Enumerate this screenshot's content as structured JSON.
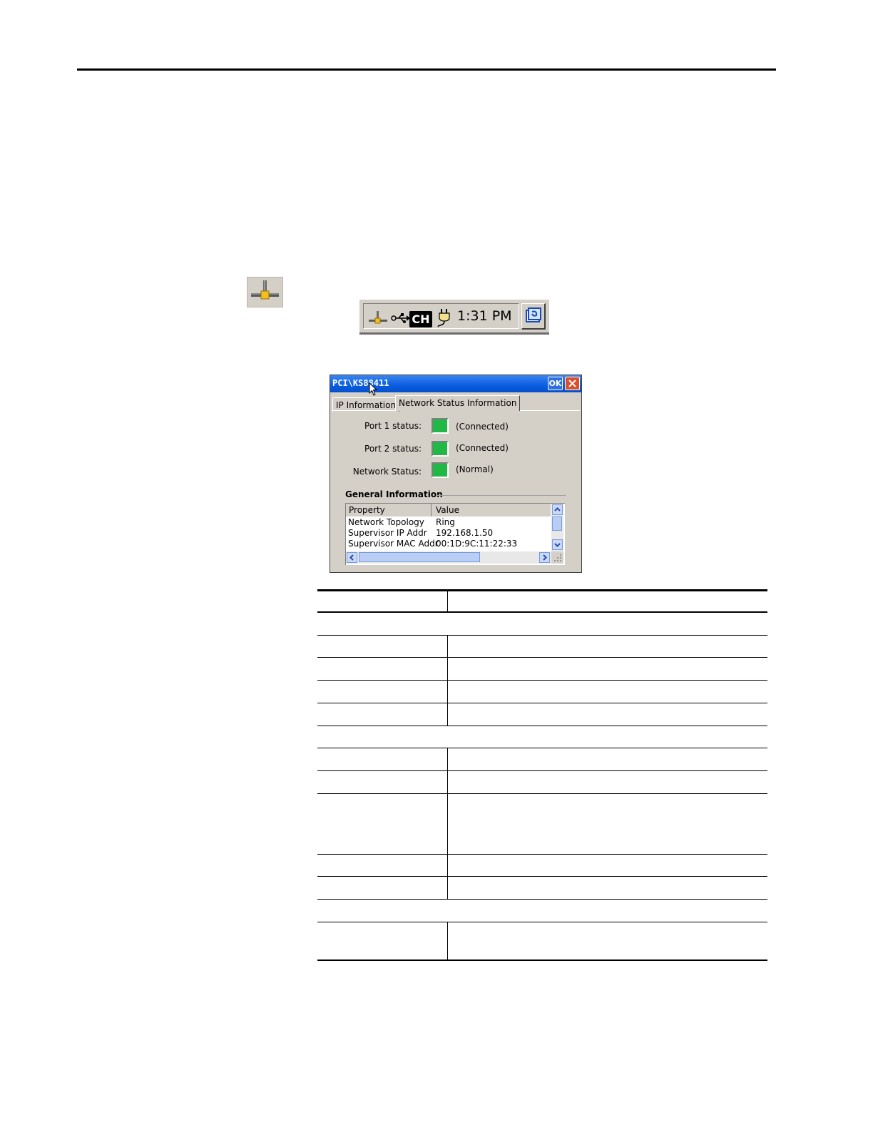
{
  "tray": {
    "input_language": "CH",
    "time": "1:31 PM"
  },
  "dialog": {
    "title": "PCI\\KS88411",
    "ok_label": "OK",
    "tabs": [
      {
        "label": "IP Information",
        "selected": false
      },
      {
        "label": "Network Status Information",
        "selected": true
      }
    ],
    "status": [
      {
        "label": "Port 1 status:",
        "value": "(Connected)",
        "color": "#22b845"
      },
      {
        "label": "Port 2 status:",
        "value": "(Connected)",
        "color": "#22b845"
      },
      {
        "label": "Network Status:",
        "value": "(Normal)",
        "color": "#22b845"
      }
    ],
    "general_info": {
      "title": "General Information",
      "columns": [
        "Property",
        "Value"
      ],
      "rows": [
        {
          "property": "Network Topology",
          "value": "Ring"
        },
        {
          "property": "Supervisor IP Addr",
          "value": "192.168.1.50"
        },
        {
          "property": "Supervisor MAC Addr",
          "value": "00:1D:9C:11:22:33"
        }
      ]
    }
  }
}
